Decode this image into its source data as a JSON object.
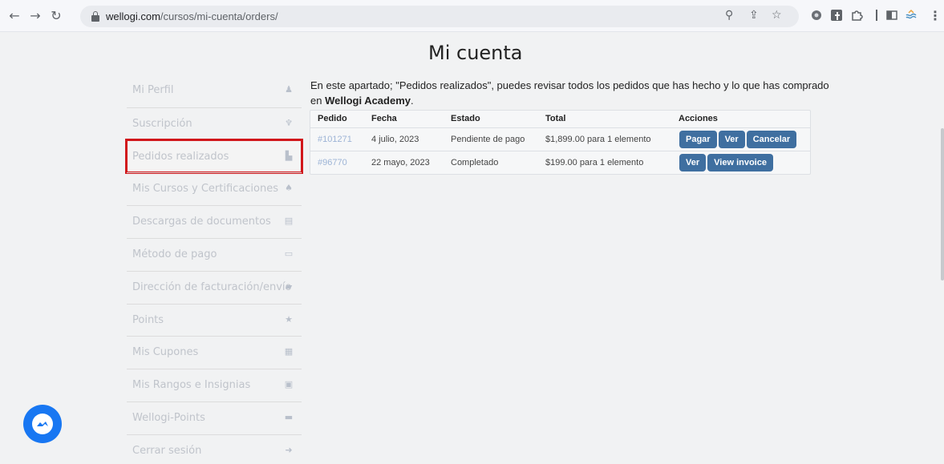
{
  "browser": {
    "url_host": "wellogi.com",
    "url_path": "/cursos/mi-cuenta/orders/"
  },
  "page": {
    "title": "Mi cuenta",
    "intro_prefix": "En este apartado; \"Pedidos realizados\", puedes revisar todos los pedidos que has hecho y lo que has comprado en ",
    "intro_brand": "Wellogi Academy",
    "intro_suffix": "."
  },
  "sidebar": {
    "items": [
      {
        "label": "Mi Perfil",
        "icon": "user-icon"
      },
      {
        "label": "Suscripción",
        "icon": "trophy-icon"
      },
      {
        "label": "Pedidos realizados",
        "icon": "orders-icon"
      },
      {
        "label": "Mis Cursos y Certificaciones",
        "icon": "courses-icon"
      },
      {
        "label": "Descargas de documentos",
        "icon": "download-icon"
      },
      {
        "label": "Método de pago",
        "icon": "card-icon"
      },
      {
        "label": "Dirección de facturación/envío",
        "icon": "truck-icon"
      },
      {
        "label": "Points",
        "icon": "star-icon"
      },
      {
        "label": "Mis Cupones",
        "icon": "coupon-icon"
      },
      {
        "label": "Mis Rangos e Insignias",
        "icon": "badge-icon"
      },
      {
        "label": "Wellogi-Points",
        "icon": "points-icon"
      },
      {
        "label": "Cerrar sesión",
        "icon": "logout-icon"
      }
    ],
    "active_index": 2,
    "highlight_color": "#d1171b"
  },
  "orders": {
    "headers": [
      "Pedido",
      "Fecha",
      "Estado",
      "Total",
      "Acciones"
    ],
    "rows": [
      {
        "order": "#101271",
        "date": "4 julio, 2023",
        "status": "Pendiente de pago",
        "total": "$1,899.00 para 1 elemento",
        "actions": [
          "Pagar",
          "Ver",
          "Cancelar"
        ]
      },
      {
        "order": "#96770",
        "date": "22 mayo, 2023",
        "status": "Completado",
        "total": "$199.00 para 1 elemento",
        "actions": [
          "Ver",
          "View invoice"
        ]
      }
    ],
    "button_color": "#3f6fa0"
  },
  "chat": {
    "icon": "messenger-icon",
    "color": "#1877f2"
  }
}
